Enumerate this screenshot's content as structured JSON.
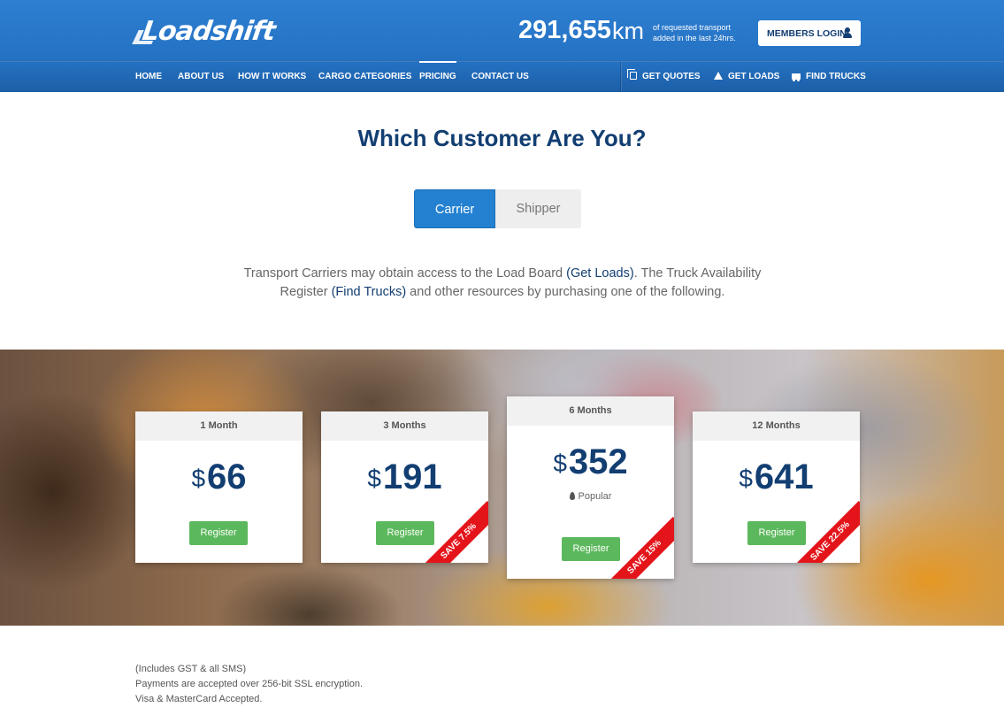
{
  "header": {
    "logo_text": "Loadshift",
    "counter": {
      "value": "291,655",
      "unit": "km",
      "description_line1": "of requested transport",
      "description_line2": "added in the last 24hrs."
    },
    "login_label": "MEMBERS LOGIN"
  },
  "nav": {
    "items": [
      "HOME",
      "ABOUT US",
      "HOW IT WORKS",
      "CARGO CATEGORIES",
      "PRICING",
      "CONTACT US"
    ],
    "active": "PRICING",
    "actions": [
      {
        "label": "GET QUOTES",
        "icon": "quotes-icon"
      },
      {
        "label": "GET LOADS",
        "icon": "road-icon"
      },
      {
        "label": "FIND TRUCKS",
        "icon": "truck-icon"
      }
    ]
  },
  "main": {
    "title": "Which Customer Are You?",
    "tabs": [
      "Carrier",
      "Shipper"
    ],
    "selected_tab": "Carrier",
    "intro": {
      "part1": "Transport Carriers may obtain access to the Load Board ",
      "link1": "(Get Loads)",
      "part2": ". The Truck Availability Register ",
      "link2": "(Find Trucks)",
      "part3": " and other resources by purchasing one of the following."
    }
  },
  "plans": [
    {
      "name": "1 Month",
      "currency": "$",
      "price": "66",
      "button": "Register"
    },
    {
      "name": "3 Months",
      "currency": "$",
      "price": "191",
      "button": "Register",
      "ribbon": "SAVE 7.5%"
    },
    {
      "name": "6 Months",
      "currency": "$",
      "price": "352",
      "badge": "Popular",
      "button": "Register",
      "ribbon": "SAVE 15%"
    },
    {
      "name": "12 Months",
      "currency": "$",
      "price": "641",
      "button": "Register",
      "ribbon": "SAVE 22.5%"
    }
  ],
  "notes": [
    "(Includes GST & all SMS)",
    "Payments are accepted over 256-bit SSL encryption.",
    "Visa & MasterCard Accepted."
  ],
  "colors": {
    "brand_blue": "#2471c2",
    "navy_text": "#123e72",
    "register_green": "#5cb85c",
    "ribbon_red": "#e3141a"
  }
}
